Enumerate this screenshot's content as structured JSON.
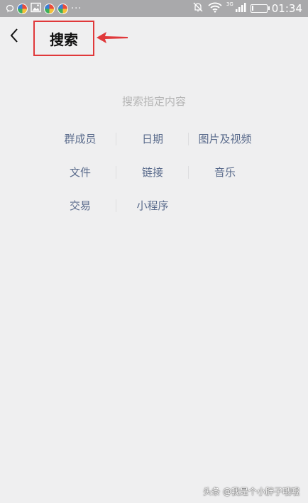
{
  "status_bar": {
    "time": "01:34",
    "more_indicator": "···",
    "network_type": "3G",
    "icons": [
      "chat-bubble-icon",
      "app-icon",
      "image-icon",
      "app-icon",
      "app-icon",
      "mute-icon",
      "wifi-icon",
      "signal-icon",
      "battery-icon"
    ]
  },
  "header": {
    "title": "搜索",
    "back_icon": "chevron-left-icon",
    "annotation_color": "#e0383a"
  },
  "search": {
    "hint": "搜索指定内容",
    "categories": [
      [
        "群成员",
        "日期",
        "图片及视频"
      ],
      [
        "文件",
        "链接",
        "音乐"
      ],
      [
        "交易",
        "小程序"
      ]
    ]
  },
  "watermark": "头条 @我是个小胖子哦哦",
  "colors": {
    "background": "#efeff0",
    "status_bar": "#a9a9ab",
    "category_text": "#5a6b8c",
    "hint_text": "#b4b4b4"
  }
}
